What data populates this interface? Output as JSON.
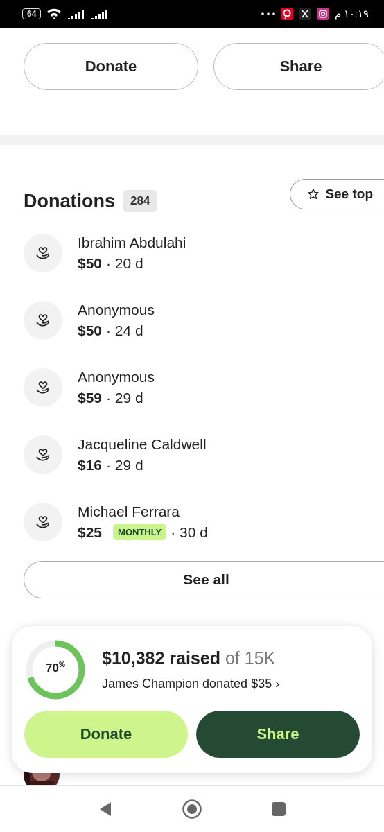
{
  "status_bar": {
    "battery": "64",
    "time": "١٠:١٩ م"
  },
  "top_buttons": [
    "Donate",
    "Share"
  ],
  "donations": {
    "title": "Donations",
    "count": "284",
    "see_top": "See top",
    "items": [
      {
        "name": "Ibrahim Abdulahi",
        "amount": "$50",
        "age": "· 20 d"
      },
      {
        "name": "Anonymous",
        "amount": "$50",
        "age": "· 24 d"
      },
      {
        "name": "Anonymous",
        "amount": "$59",
        "age": "· 29 d"
      },
      {
        "name": "Jacqueline Caldwell",
        "amount": "$16",
        "age": "· 29 d"
      },
      {
        "name": "Michael Ferrara",
        "amount": "$25",
        "badge": "MONTHLY",
        "age": "· 30 d"
      }
    ],
    "see_all": "See all"
  },
  "progress_card": {
    "level": 0.7,
    "percent": "70$^{%}$",
    "raised": "**$10,382 raised** of 15K",
    "latest": "James Champion donated $35 ›",
    "buttons": [
      {
        "label": "Donate",
        "kind": "primary"
      },
      {
        "label": "Share",
        "kind": "dark"
      }
    ]
  }
}
